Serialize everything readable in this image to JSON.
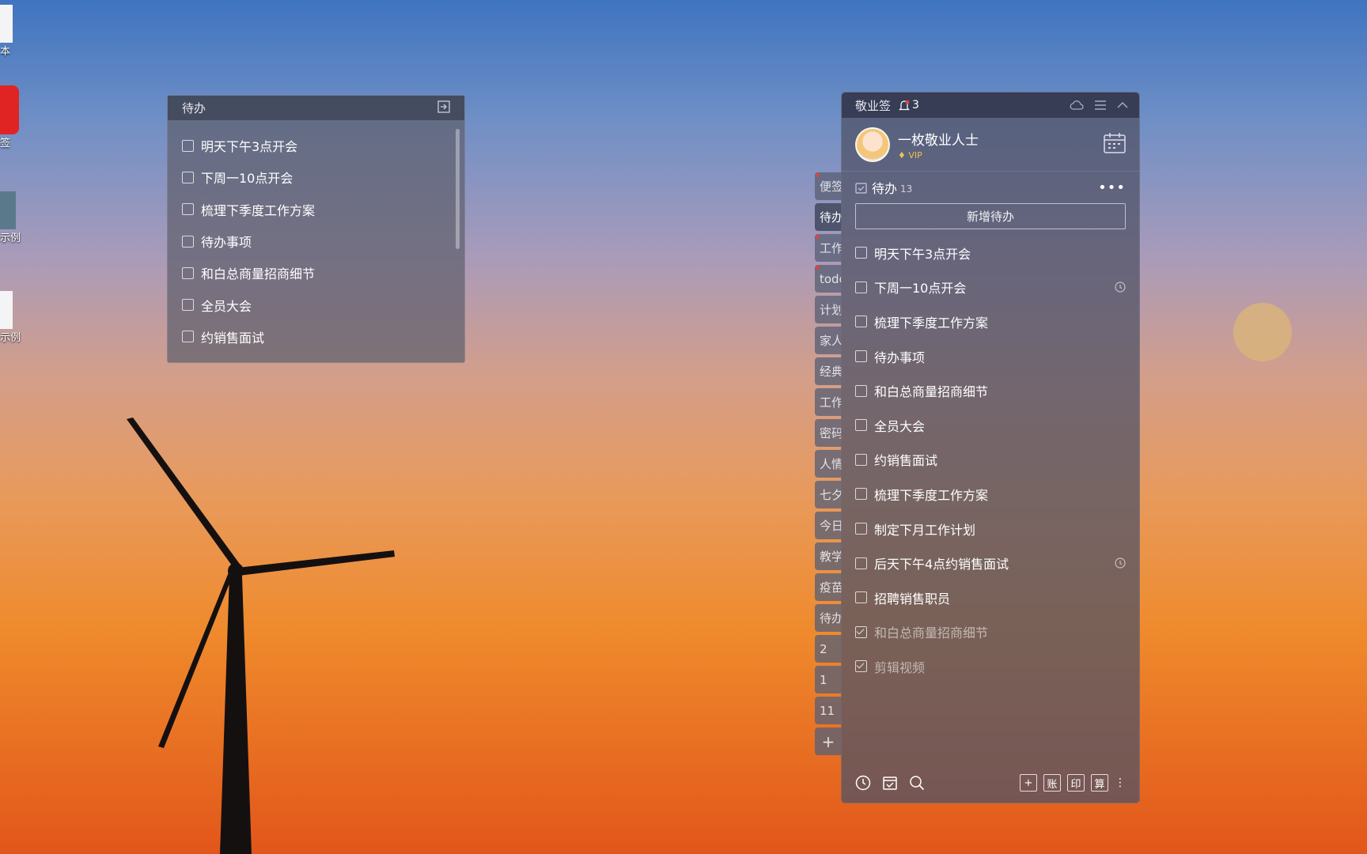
{
  "desktop": {
    "icons": [
      {
        "label": "本",
        "icon": "document-icon"
      },
      {
        "label": "签",
        "icon": "app-red-icon"
      },
      {
        "label": "示例",
        "icon": "spreadsheet-icon"
      },
      {
        "label": "示例",
        "icon": "file-icon"
      }
    ]
  },
  "mini_widget": {
    "title": "待办",
    "items": [
      "明天下午3点开会",
      "下周一10点开会",
      "梳理下季度工作方案",
      "待办事项",
      "和白总商量招商细节",
      "全员大会",
      "约销售面试"
    ]
  },
  "side_tabs": [
    "便签",
    "待办",
    "工作",
    "todo",
    "计划",
    "家人",
    "经典",
    "工作",
    "密码",
    "人情",
    "七夕",
    "今日",
    "教学",
    "疫苗",
    "待办",
    "2",
    "1",
    "11",
    "+"
  ],
  "side_tabs_with_dot": [
    0,
    2,
    3
  ],
  "active_tab": 1,
  "panel": {
    "brand": "敬业签",
    "notification_count": "3",
    "user_name": "一枚敬业人士",
    "vip_label": "VIP",
    "todo_title": "待办",
    "todo_count": "13",
    "add_button": "新增待办",
    "items": [
      {
        "text": "明天下午3点开会",
        "done": false,
        "alarm": false
      },
      {
        "text": "下周一10点开会",
        "done": false,
        "alarm": true
      },
      {
        "text": "梳理下季度工作方案",
        "done": false,
        "alarm": false
      },
      {
        "text": "待办事项",
        "done": false,
        "alarm": false
      },
      {
        "text": "和白总商量招商细节",
        "done": false,
        "alarm": false
      },
      {
        "text": "全员大会",
        "done": false,
        "alarm": false
      },
      {
        "text": "约销售面试",
        "done": false,
        "alarm": false
      },
      {
        "text": "梳理下季度工作方案",
        "done": false,
        "alarm": false
      },
      {
        "text": "制定下月工作计划",
        "done": false,
        "alarm": false
      },
      {
        "text": "后天下午4点约销售面试",
        "done": false,
        "alarm": true
      },
      {
        "text": "招聘销售职员",
        "done": false,
        "alarm": false
      },
      {
        "text": "和白总商量招商细节",
        "done": true,
        "alarm": false
      },
      {
        "text": "剪辑视频",
        "done": true,
        "alarm": false
      }
    ],
    "footer_right": [
      "+",
      "账",
      "印",
      "算"
    ]
  }
}
